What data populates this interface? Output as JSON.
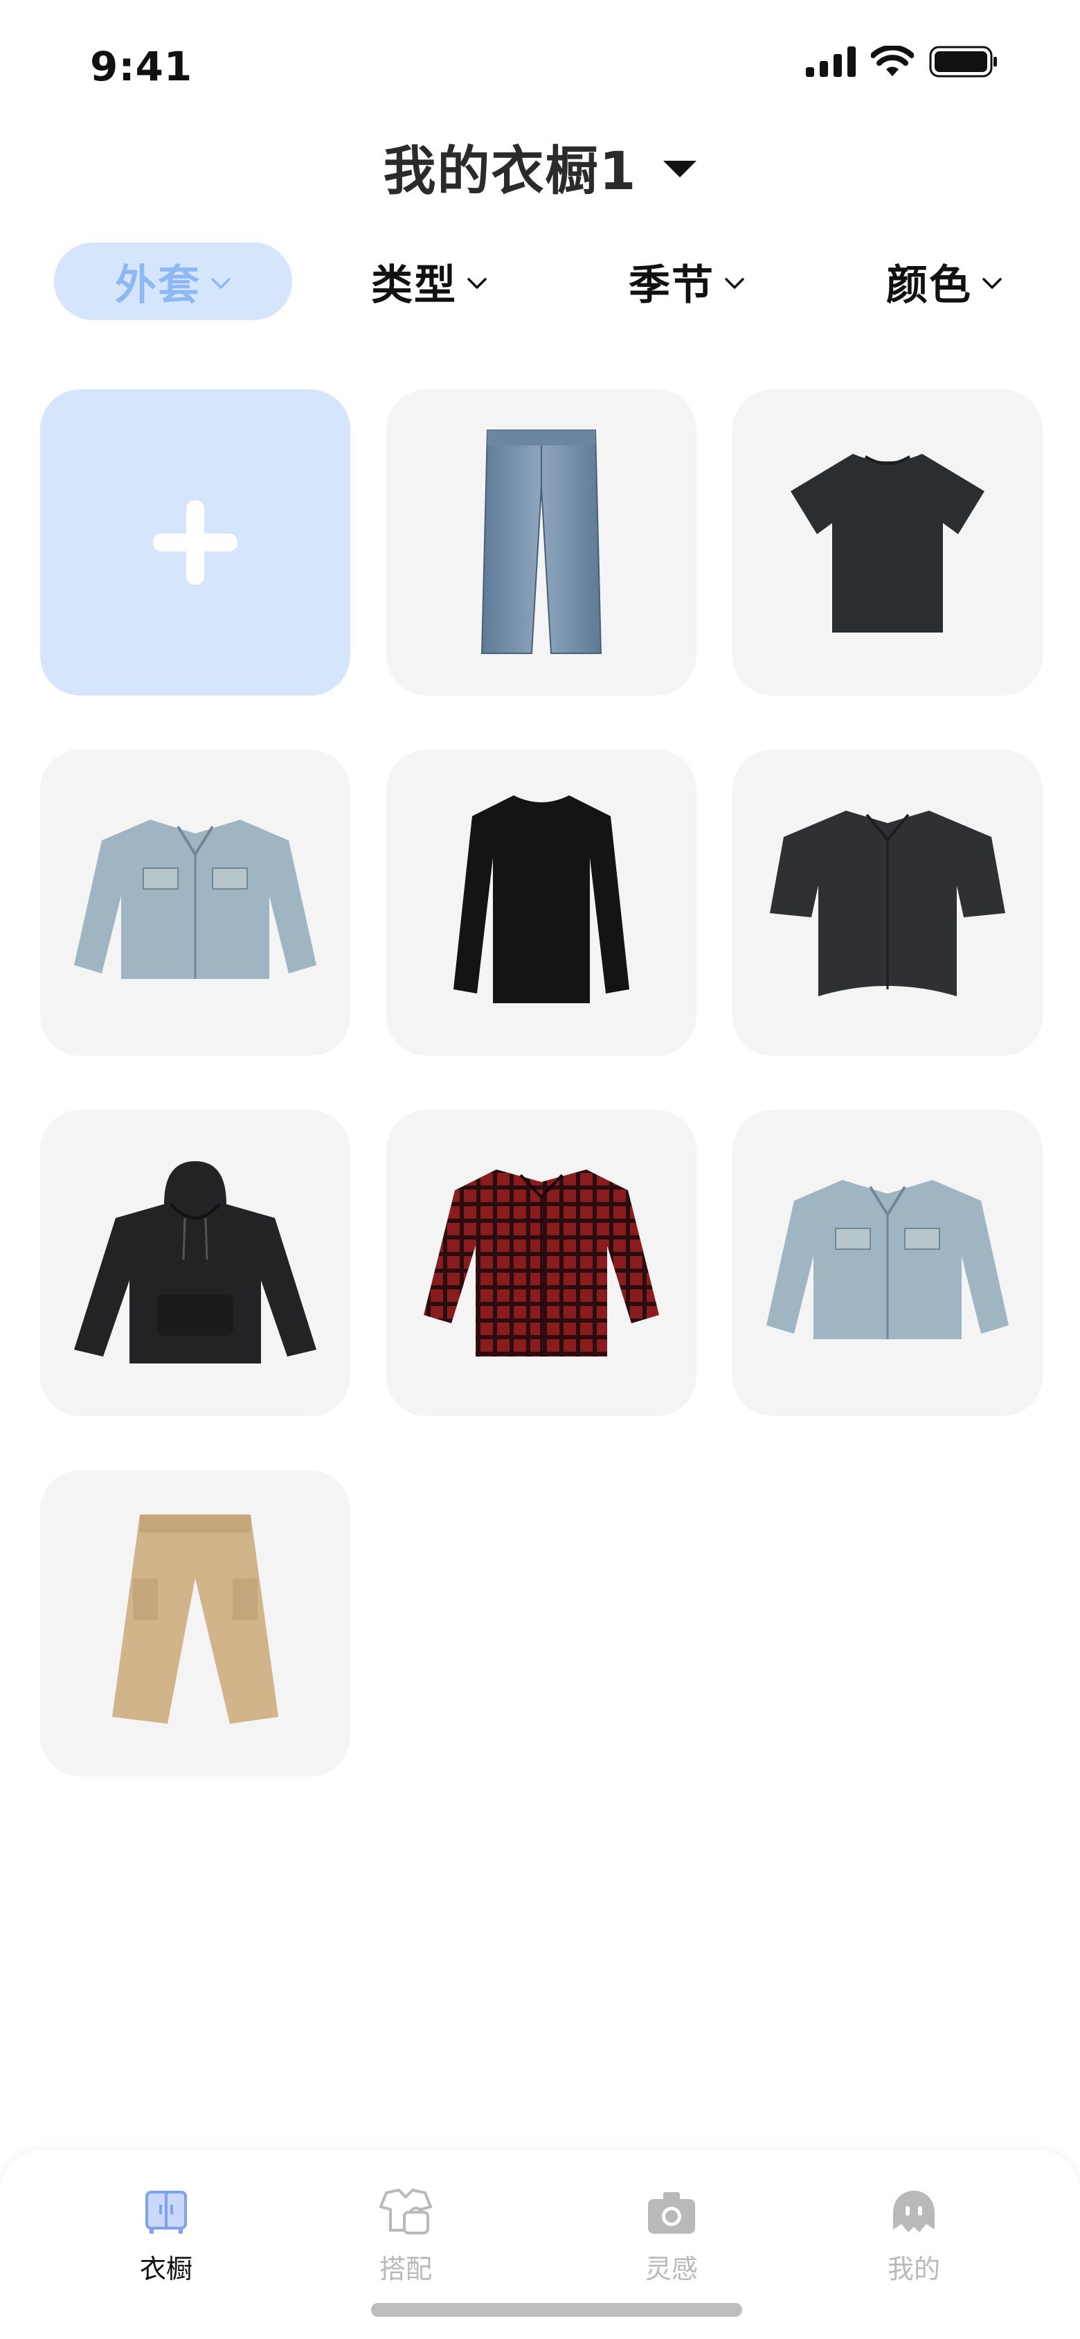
{
  "status_bar": {
    "time": "9:41"
  },
  "header": {
    "title": "我的衣橱1"
  },
  "filters": [
    {
      "label": "外套",
      "active": true
    },
    {
      "label": "类型",
      "active": false
    },
    {
      "label": "季节",
      "active": false
    },
    {
      "label": "颜色",
      "active": false
    }
  ],
  "grid": {
    "items": [
      {
        "kind": "add",
        "icon": "plus-icon"
      },
      {
        "kind": "clothing",
        "icon": "jeans-icon"
      },
      {
        "kind": "clothing",
        "icon": "black-tshirt-icon"
      },
      {
        "kind": "clothing",
        "icon": "denim-jacket-icon"
      },
      {
        "kind": "clothing",
        "icon": "black-longsleeve-icon"
      },
      {
        "kind": "clothing",
        "icon": "black-shirt-icon"
      },
      {
        "kind": "clothing",
        "icon": "black-hoodie-icon"
      },
      {
        "kind": "clothing",
        "icon": "plaid-shirt-icon"
      },
      {
        "kind": "clothing",
        "icon": "denim-jacket-icon"
      },
      {
        "kind": "clothing",
        "icon": "khaki-pants-icon"
      }
    ]
  },
  "tabbar": {
    "tabs": [
      {
        "label": "衣橱",
        "icon": "wardrobe-icon",
        "active": true
      },
      {
        "label": "搭配",
        "icon": "outfit-icon",
        "active": false
      },
      {
        "label": "灵感",
        "icon": "camera-icon",
        "active": false
      },
      {
        "label": "我的",
        "icon": "profile-icon",
        "active": false
      }
    ]
  },
  "colors": {
    "accent": "#8db8f5",
    "accent_bg": "#d5e5fc",
    "tile_bg": "#f4f4f4",
    "active_tab_icon": "#7ea2ee",
    "inactive": "#b9b9b9"
  }
}
